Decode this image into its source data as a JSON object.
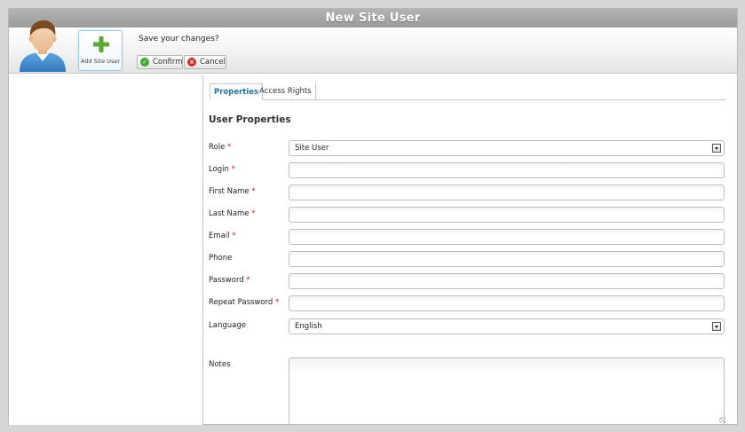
{
  "window": {
    "title": "New Site User"
  },
  "toolbar": {
    "add_button_label": "Add Site User",
    "prompt": "Save your changes?",
    "confirm_label": "Confirm",
    "cancel_label": "Cancel"
  },
  "tabs": [
    {
      "label": "Properties",
      "active": true
    },
    {
      "label": "Access Rights",
      "active": false
    }
  ],
  "form": {
    "section_title": "User Properties",
    "required_mark": "*",
    "fields": {
      "role": {
        "label": "Role",
        "value": "Site User"
      },
      "login": {
        "label": "Login",
        "value": ""
      },
      "first_name": {
        "label": "First  Name",
        "value": ""
      },
      "last_name": {
        "label": "Last  Name",
        "value": ""
      },
      "email": {
        "label": "Email",
        "value": ""
      },
      "phone": {
        "label": "Phone",
        "value": ""
      },
      "password": {
        "label": "Password",
        "value": ""
      },
      "repeat_password": {
        "label": "Repeat Password",
        "value": ""
      },
      "language": {
        "label": "Language",
        "value": "English"
      },
      "notes": {
        "label": "Notes",
        "value": ""
      }
    }
  },
  "colors": {
    "accent": "#2c6e9e",
    "required": "#c0282c",
    "confirm": "#3fa534",
    "cancel": "#c8322c",
    "add": "#5aa82d"
  },
  "icons": {
    "avatar": "user-avatar-icon",
    "add": "green-plus-icon",
    "confirm": "check-circle-icon",
    "cancel": "x-circle-icon"
  }
}
